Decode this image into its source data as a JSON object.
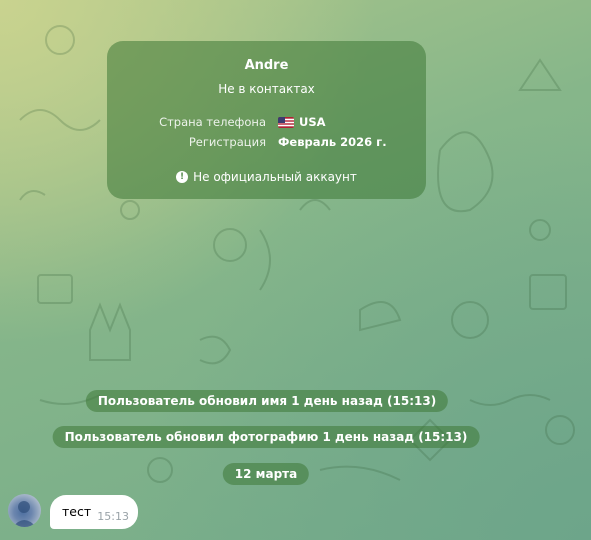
{
  "contact_card": {
    "name": "Andre",
    "status": "Не в контактах",
    "phone_country_label": "Страна телефона",
    "phone_country_value": "USA",
    "phone_country_flag": "us-flag-icon",
    "registration_label": "Регистрация",
    "registration_value": "Февраль 2026 г.",
    "note_icon": "info-icon",
    "note_text": "Не официальный аккаунт"
  },
  "service_messages": [
    "Пользователь обновил имя 1 день назад (15:13)",
    "Пользователь обновил фотографию 1 день назад (15:13)"
  ],
  "date_separator": "12 марта",
  "messages": [
    {
      "text": "тест",
      "time": "15:13",
      "avatar": "user-avatar"
    }
  ],
  "colors": {
    "card_bg": "#3e7836",
    "bubble_bg": "#ffffff",
    "time_text": "#9aa3a8"
  }
}
